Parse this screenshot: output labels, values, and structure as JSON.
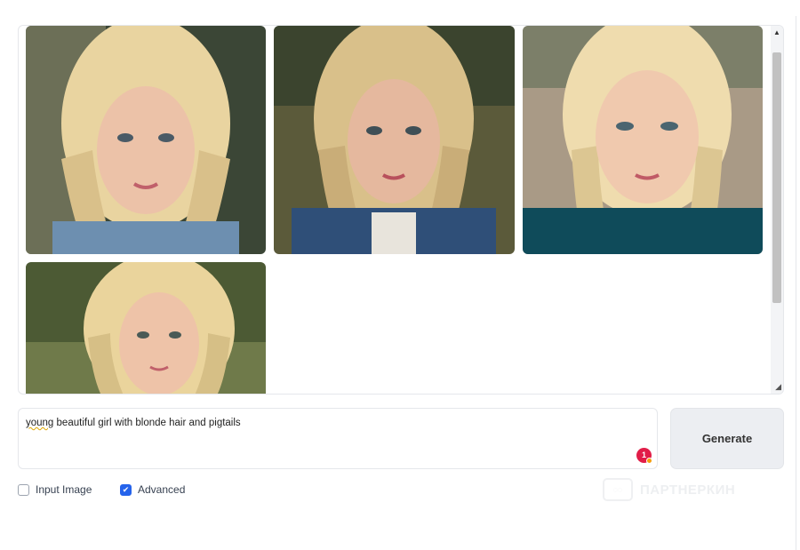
{
  "prompt": {
    "text_first_word": "young",
    "text_rest": " beautiful girl with blonde hair and pigtails",
    "notification_count": "1"
  },
  "generate_button": {
    "label": "Generate"
  },
  "options": {
    "input_image": {
      "label": "Input Image",
      "checked": false
    },
    "advanced": {
      "label": "Advanced",
      "checked": true
    }
  },
  "watermark": {
    "text": "ПАРТНЕРКИН"
  },
  "gallery": {
    "images": [
      {
        "name": "generated-image-1",
        "palette": {
          "bg": "#3b4636",
          "hair": "#e9d4a0",
          "skin": "#ecc2a8",
          "cloth": "#6d8fb0"
        }
      },
      {
        "name": "generated-image-2",
        "palette": {
          "bg": "#5b5a3a",
          "hair": "#d9c08a",
          "skin": "#e5b89e",
          "cloth": "#2f4f78"
        }
      },
      {
        "name": "generated-image-3",
        "palette": {
          "bg": "#a99a86",
          "hair": "#efdcae",
          "skin": "#f0c9ae",
          "cloth": "#0f4b5a"
        }
      },
      {
        "name": "generated-image-4",
        "palette": {
          "bg": "#4c5a34",
          "hair": "#ead49c",
          "skin": "#eec3a8",
          "cloth": "#6b6a55"
        }
      }
    ]
  }
}
